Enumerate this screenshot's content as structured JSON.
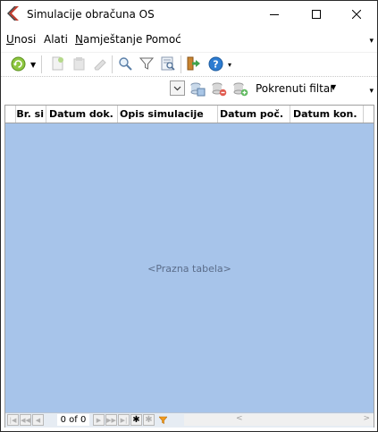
{
  "window": {
    "title": "Simulacije obračuna OS"
  },
  "menu": {
    "items": [
      {
        "label": "Unosi",
        "underline": "U",
        "rest": "nosi"
      },
      {
        "label": "Alati"
      },
      {
        "label": "Namještanje",
        "underline": "N",
        "rest": "amještanje"
      },
      {
        "label": "Pomoć"
      }
    ]
  },
  "toolbar": {
    "icons": [
      "refresh-icon",
      "new-document-icon",
      "edit-document-icon",
      "delete-icon",
      "search-icon",
      "filter-icon",
      "find-in-list-icon",
      "exit-icon",
      "help-icon"
    ]
  },
  "filterbar": {
    "filter_label": "Pokrenuti filtar",
    "icons": [
      "database-copy-icon",
      "database-remove-icon",
      "database-add-icon"
    ]
  },
  "grid": {
    "columns": [
      "Br. si",
      "Datum dok.",
      "Opis simulacije",
      "Datum poč.",
      "Datum kon."
    ],
    "empty_text": "<Prazna tabela>"
  },
  "navigator": {
    "count_text": "0 of 0"
  },
  "colors": {
    "grid_background": "#a7c4ea",
    "header_background": "#ffffff",
    "navigator_background": "#e6ecf3"
  }
}
